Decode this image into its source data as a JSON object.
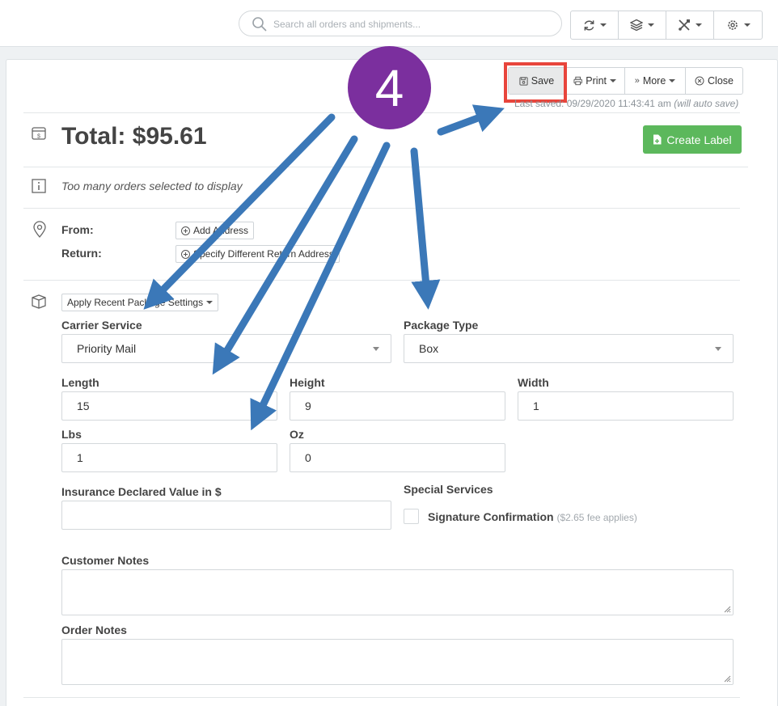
{
  "topbar": {
    "search_placeholder": "Search all orders and shipments...",
    "buttons": [
      {
        "icon": "sync-icon"
      },
      {
        "icon": "layers-icon"
      },
      {
        "icon": "tools-icon"
      },
      {
        "icon": "gear-icon"
      }
    ]
  },
  "actions": {
    "save": "Save",
    "print": "Print",
    "more": "More",
    "close": "Close",
    "last_saved": "Last saved: 09/29/2020 11:43:41 am",
    "auto_save_hint": "(will auto save)"
  },
  "summary": {
    "total": "Total: $95.61",
    "create_label": "Create Label"
  },
  "info": {
    "message": "Too many orders selected to display"
  },
  "address": {
    "from_label": "From:",
    "return_label": "Return:",
    "add_address": "Add Address",
    "specify_return": "Specify Different Return Address"
  },
  "package": {
    "apply_recent": "Apply Recent Package Settings",
    "carrier_service_label": "Carrier Service",
    "carrier_service_value": "Priority Mail",
    "package_type_label": "Package Type",
    "package_type_value": "Box",
    "length_label": "Length",
    "length_value": "15",
    "height_label": "Height",
    "height_value": "9",
    "width_label": "Width",
    "width_value": "1",
    "lbs_label": "Lbs",
    "lbs_value": "1",
    "oz_label": "Oz",
    "oz_value": "0",
    "insurance_label": "Insurance Declared Value in $",
    "insurance_value": "",
    "special_services_label": "Special Services",
    "signature_label": "Signature Confirmation",
    "signature_fee": "($2.65 fee applies)",
    "signature_checked": false,
    "customer_notes_label": "Customer Notes",
    "order_notes_label": "Order Notes"
  },
  "annotation": {
    "step_number": "4",
    "arrow_color": "#3b78b8",
    "badge_color": "#7b2f9e",
    "highlight_color": "#e8453c"
  },
  "colors": {
    "primary_green": "#5cb85c"
  }
}
